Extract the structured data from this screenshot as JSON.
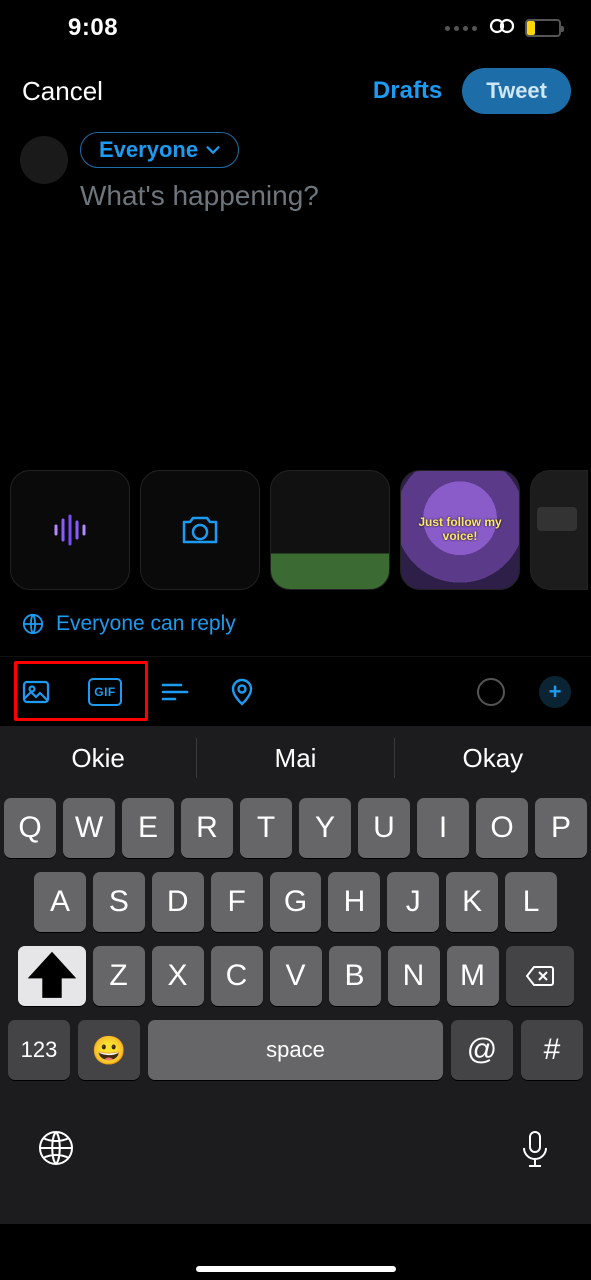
{
  "status": {
    "time": "9:08"
  },
  "nav": {
    "cancel": "Cancel",
    "drafts": "Drafts",
    "tweet": "Tweet"
  },
  "composer": {
    "audience": "Everyone",
    "placeholder": "What's happening?"
  },
  "media": {
    "voice_caption": "Just follow my voice!"
  },
  "reply": {
    "text": "Everyone can reply"
  },
  "toolbar": {
    "gif": "GIF",
    "add": "+"
  },
  "keyboard": {
    "suggestions": [
      "Okie",
      "Mai",
      "Okay"
    ],
    "row1": [
      "Q",
      "W",
      "E",
      "R",
      "T",
      "Y",
      "U",
      "I",
      "O",
      "P"
    ],
    "row2": [
      "A",
      "S",
      "D",
      "F",
      "G",
      "H",
      "J",
      "K",
      "L"
    ],
    "row3": [
      "Z",
      "X",
      "C",
      "V",
      "B",
      "N",
      "M"
    ],
    "numbers": "123",
    "space": "space",
    "at": "@",
    "hash": "#"
  }
}
